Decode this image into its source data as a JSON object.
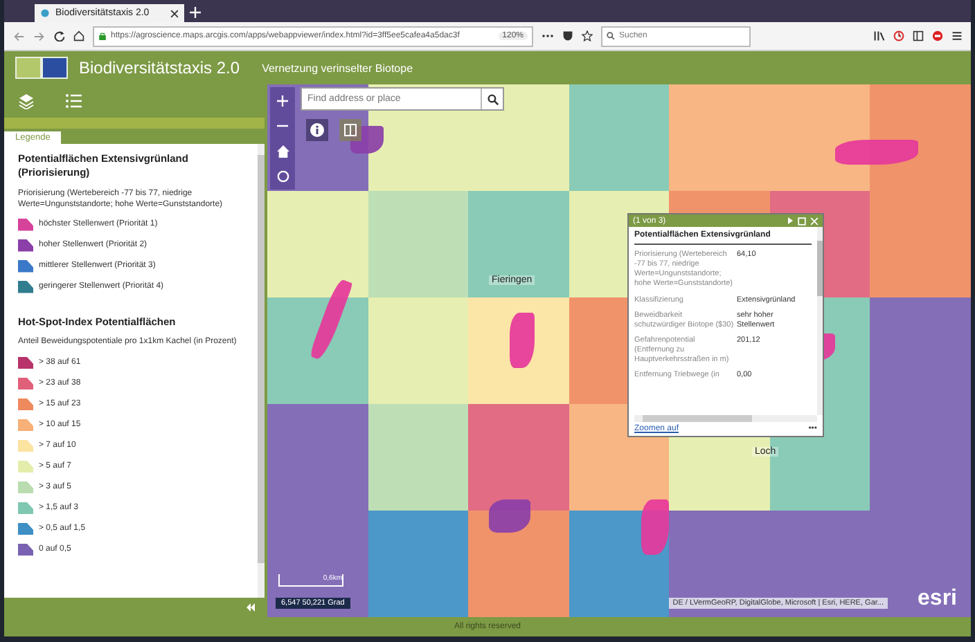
{
  "browser": {
    "tab_title": "Biodiversitätstaxis 2.0",
    "url": "https://agroscience.maps.arcgis.com/apps/webappviewer/index.html?id=3ff5ee5cafea4a5dac3f",
    "zoom": "120%",
    "search_placeholder": "Suchen"
  },
  "app": {
    "title": "Biodiversitätstaxis 2.0",
    "subtitle": "Vernetzung verinselter Biotope"
  },
  "panel": {
    "tab": "Legende",
    "sections": [
      {
        "title": "Potentialflächen Extensivgrünland (Priorisierung)",
        "subtitle": "Priorisierung (Wertebereich -77 bis 77, niedrige Werte=Ungunststandorte; hohe Werte=Gunststandorte)",
        "items": [
          {
            "label": "höchster Stellenwert (Priorität 1)",
            "color": "#d6439b"
          },
          {
            "label": "hoher Stellenwert (Priorität 2)",
            "color": "#8b3fa8"
          },
          {
            "label": "mittlerer Stellenwert (Priorität 3)",
            "color": "#3a78c8"
          },
          {
            "label": "geringerer Stellenwert (Priorität 4)",
            "color": "#2f7d8e"
          }
        ]
      },
      {
        "title": "Hot-Spot-Index Potentialflächen",
        "subtitle": "Anteil Beweidungspotentiale pro 1x1km Kachel (in Prozent)",
        "items": [
          {
            "label": "> 38 auf 61",
            "color": "#b8336a"
          },
          {
            "label": "> 23 auf 38",
            "color": "#e0607a"
          },
          {
            "label": "> 15 auf 23",
            "color": "#ef8a5e"
          },
          {
            "label": "> 10 auf 15",
            "color": "#f6b078"
          },
          {
            "label": "> 7 auf 10",
            "color": "#fbe3a0"
          },
          {
            "label": "> 5 auf 7",
            "color": "#e4eeaa"
          },
          {
            "label": "> 3 auf 5",
            "color": "#b9dcb0"
          },
          {
            "label": "> 1,5 auf 3",
            "color": "#7fc7b0"
          },
          {
            "label": "> 0,5 auf 1,5",
            "color": "#3d8fc4"
          },
          {
            "label": "0 auf 0,5",
            "color": "#7a62b2"
          }
        ]
      }
    ]
  },
  "map": {
    "search_placeholder": "Find address or place",
    "place_labels": [
      "Fieringen",
      "Loch"
    ],
    "scale": "0,6km",
    "coordinates": "6,547 50,221 Grad",
    "attribution": "DE / LVermGeoRP, DigitalGlobe, Microsoft | Esri, HERE, Gar...",
    "logo": "esri"
  },
  "popup": {
    "counter": "(1 von 3)",
    "title": "Potentialflächen Extensivgrünland",
    "fields": [
      {
        "name": "Priorisierung (Wertebereich -77 bis 77, niedrige Werte=Ungunststandorte; hohe Werte=Gunststandorte)",
        "value": "64,10"
      },
      {
        "name": "Klassifizierung",
        "value": "Extensivgrünland"
      },
      {
        "name": "Beweidbarkeit schutzwürdiger Biotope ($30)",
        "value": "sehr hoher Stellenwert"
      },
      {
        "name": "Gefahrenpotential (Entfernung zu Hauptverkehrsstraßen in m)",
        "value": "201,12"
      },
      {
        "name": "Entfernung Triebwege (in",
        "value": "0,00"
      }
    ],
    "link": "Zoomen auf",
    "more": "•••"
  },
  "footer": "All rights reserved"
}
